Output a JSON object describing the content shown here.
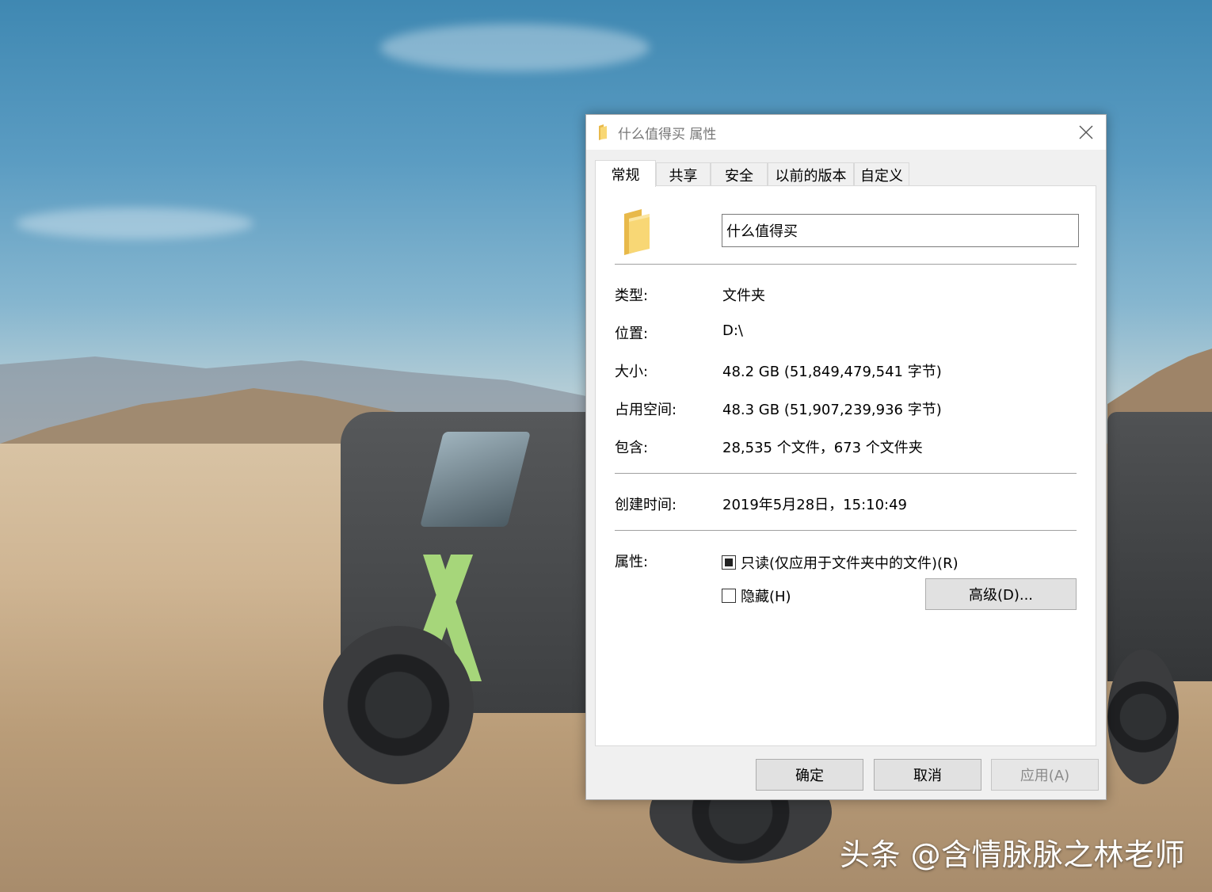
{
  "dialog": {
    "title": "什么值得买 属性",
    "tabs": [
      {
        "label": "常规",
        "active": true
      },
      {
        "label": "共享",
        "active": false
      },
      {
        "label": "安全",
        "active": false
      },
      {
        "label": "以前的版本",
        "active": false
      },
      {
        "label": "自定义",
        "active": false
      }
    ],
    "folder_name": "什么值得买",
    "fields": {
      "type_label": "类型:",
      "type_value": "文件夹",
      "location_label": "位置:",
      "location_value": "D:\\",
      "size_label": "大小:",
      "size_value": "48.2 GB (51,849,479,541 字节)",
      "disk_size_label": "占用空间:",
      "disk_size_value": "48.3 GB (51,907,239,936 字节)",
      "contains_label": "包含:",
      "contains_value": "28,535 个文件，673 个文件夹",
      "created_label": "创建时间:",
      "created_value": "2019年5月28日，15:10:49",
      "attributes_label": "属性:"
    },
    "attributes": {
      "readonly_label": "只读(仅应用于文件夹中的文件)(R)",
      "readonly_state": "indeterminate",
      "hidden_label": "隐藏(H)",
      "hidden_state": "unchecked",
      "advanced_button": "高级(D)..."
    },
    "buttons": {
      "ok": "确定",
      "cancel": "取消",
      "apply": "应用(A)"
    }
  },
  "watermark": "头条 @含情脉脉之林老师",
  "colors": {
    "folder_yellow": "#f8d775",
    "folder_dark": "#e8b94a",
    "button_face": "#e1e1e1",
    "panel_bg": "#ffffff",
    "dialog_bg": "#f0f0f0"
  }
}
